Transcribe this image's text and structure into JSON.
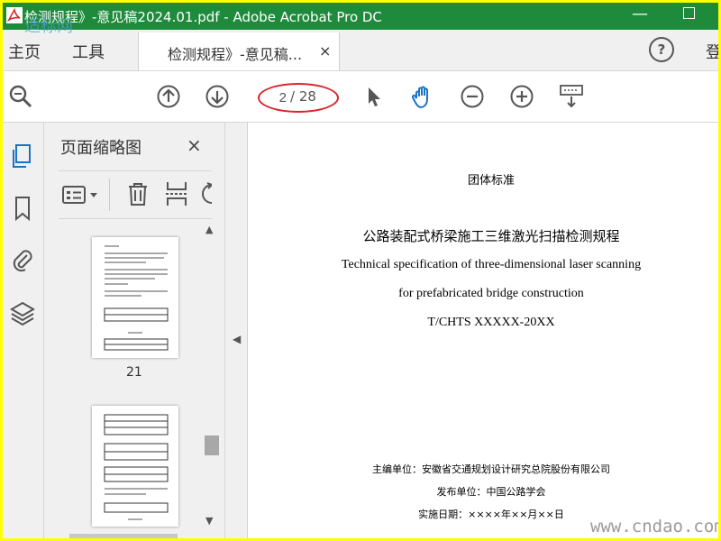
{
  "window": {
    "title": "检测规程》-意见稿2024.01.pdf - Adobe Acrobat Pro DC",
    "colors": {
      "titlebar": "#1e8a3c",
      "frame": "#ffff00",
      "annotation": "#d9262a",
      "accent_blue": "#1a73c7"
    }
  },
  "menu": {
    "home": "主页",
    "tools": "工具",
    "doc_tab": "检测规程》-意见稿...",
    "doc_tab_close": "×",
    "help": "?",
    "signin": "登"
  },
  "toolbar": {
    "current_page": "2",
    "total_pages": "/ 28"
  },
  "panel": {
    "title": "页面缩略图",
    "close": "×",
    "thumbnails": [
      {
        "label": "21"
      },
      {
        "label": ""
      }
    ]
  },
  "document": {
    "standard_type": "团体标准",
    "title_cn": "公路装配式桥梁施工三维激光扫描检测规程",
    "title_en_1": "Technical specification of three-dimensional laser scanning",
    "title_en_2": "for prefabricated bridge construction",
    "code": "T/CHTS XXXXX-20XX",
    "editor": "主编单位：安徽省交通规划设计研究总院股份有限公司",
    "publisher": "发布单位：中国公路学会",
    "effective_date": "实施日期：××××年××月××日"
  },
  "watermarks": {
    "top_left": "适标网",
    "bottom_right": "www.cndao.com"
  },
  "icons": {
    "toolbar": [
      "search-zoom-icon",
      "prev-page-icon",
      "next-page-icon",
      "select-arrow-icon",
      "hand-icon",
      "zoom-out-icon",
      "zoom-in-icon",
      "keyboard-scroll-icon"
    ],
    "rail": [
      "pages-icon",
      "bookmark-icon",
      "attachment-icon",
      "layers-icon"
    ],
    "panel_tools": [
      "thumbnail-options-icon",
      "delete-icon",
      "split-icon",
      "rotate-icon"
    ]
  }
}
